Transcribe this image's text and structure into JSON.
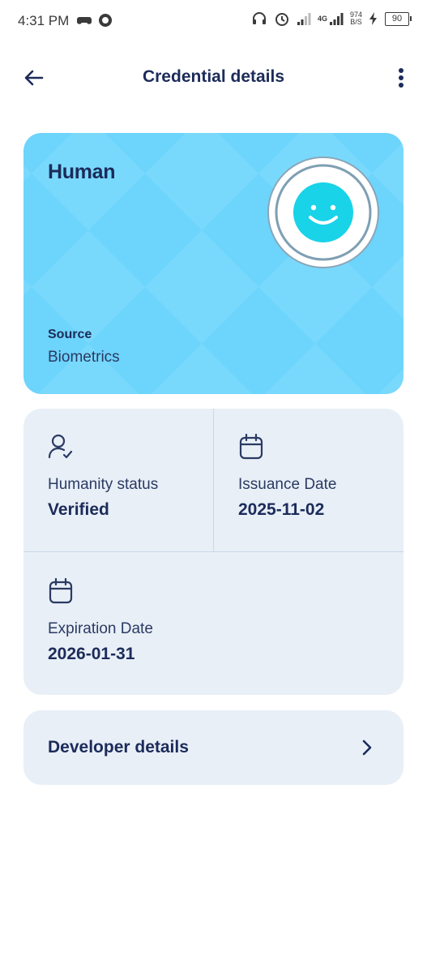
{
  "status_bar": {
    "time": "4:31 PM",
    "network": "4G",
    "speed_value": "974",
    "speed_unit": "B/S",
    "battery": "90"
  },
  "app_bar": {
    "title": "Credential details"
  },
  "credential": {
    "brand": "Human",
    "source_label": "Source",
    "source_value": "Biometrics",
    "colors": {
      "card": "#6dd4fc",
      "avatar": "#19d3e8"
    }
  },
  "info": {
    "humanity_status": {
      "label": "Humanity status",
      "value": "Verified",
      "icon": "user-check-icon"
    },
    "issuance_date": {
      "label": "Issuance Date",
      "value": "2025-11-02",
      "icon": "calendar-icon"
    },
    "expiration_date": {
      "label": "Expiration Date",
      "value": "2026-01-31",
      "icon": "calendar-icon"
    }
  },
  "developer": {
    "label": "Developer details"
  }
}
